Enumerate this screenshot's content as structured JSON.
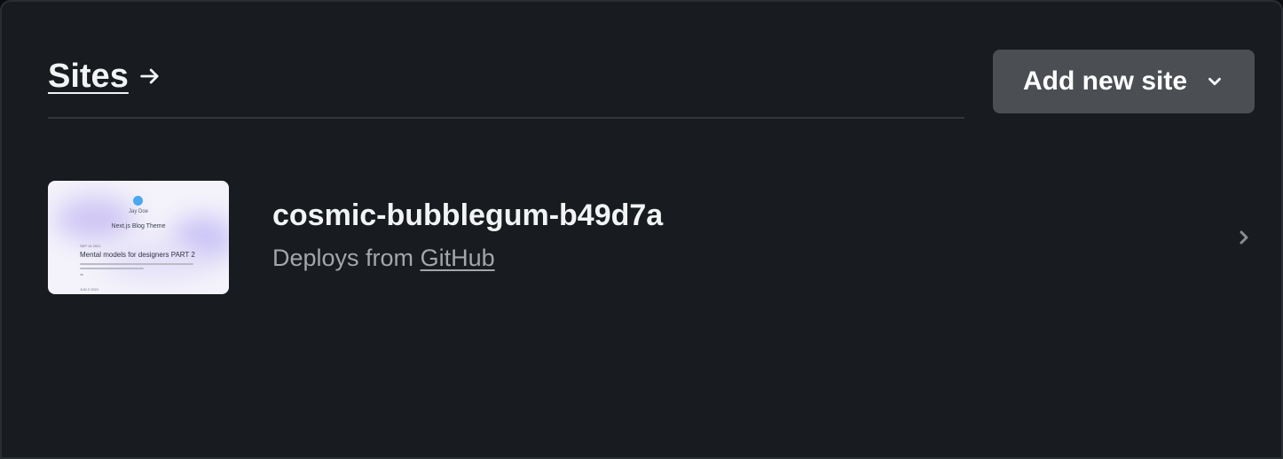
{
  "header": {
    "title": "Sites",
    "title_icon": "arrow-right-icon"
  },
  "actions": {
    "add_site_label": "Add new site",
    "add_site_icon": "chevron-down-icon"
  },
  "sites": [
    {
      "name": "cosmic-bubblegum-b49d7a",
      "deploy_prefix": "Deploys from",
      "deploy_source": "GitHub",
      "row_icon": "chevron-right-icon",
      "thumbnail": {
        "author": "Jay Doe",
        "theme": "Next.js Blog Theme",
        "date1": "SEP 14 2021",
        "post_title": "Mental models for designers PART 2",
        "date2": "JUN 2 2021"
      }
    }
  ],
  "colors": {
    "background": "#181b1f",
    "button": "#4b4f54",
    "text_primary": "#f2f3f4",
    "text_secondary": "#a3a6ab"
  }
}
